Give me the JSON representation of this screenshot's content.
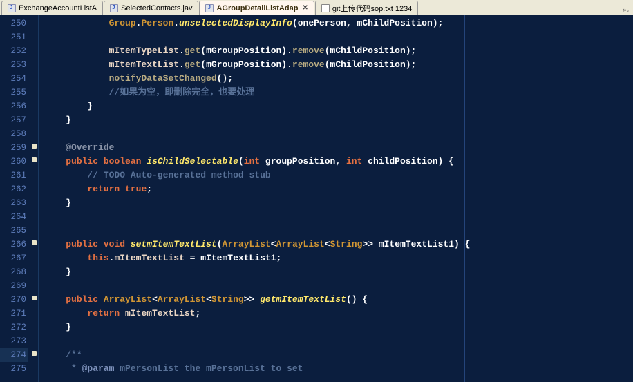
{
  "tabs": [
    {
      "label": "ExchangeAccountListA",
      "icon": "java",
      "active": false
    },
    {
      "label": "SelectedContacts.jav",
      "icon": "java",
      "active": false
    },
    {
      "label": "AGroupDetailListAdap",
      "icon": "java",
      "active": true
    },
    {
      "label": "git上传代码sop.txt 1234",
      "icon": "txt",
      "active": false
    }
  ],
  "overflow_label": "»₃",
  "line_start": 250,
  "line_end": 275,
  "markers": {
    "259": true,
    "260": true,
    "266": true,
    "270": true,
    "274": true
  },
  "highlight_gutter": {
    "274": true
  },
  "code": {
    "250": [
      {
        "t": "            ",
        "c": "tk-default"
      },
      {
        "t": "Group",
        "c": "tk-type"
      },
      {
        "t": ".",
        "c": "tk-punct"
      },
      {
        "t": "Person",
        "c": "tk-type"
      },
      {
        "t": ".",
        "c": "tk-punct"
      },
      {
        "t": "unselectedDisplayInfo",
        "c": "tk-method"
      },
      {
        "t": "(",
        "c": "tk-punct"
      },
      {
        "t": "onePerson",
        "c": "tk-ident"
      },
      {
        "t": ", ",
        "c": "tk-punct"
      },
      {
        "t": "mChildPosition",
        "c": "tk-ident"
      },
      {
        "t": ");",
        "c": "tk-punct"
      }
    ],
    "251": [],
    "252": [
      {
        "t": "            ",
        "c": "tk-default"
      },
      {
        "t": "mItemTypeList",
        "c": "tk-field"
      },
      {
        "t": ".",
        "c": "tk-punct"
      },
      {
        "t": "get",
        "c": "tk-call"
      },
      {
        "t": "(",
        "c": "tk-punct"
      },
      {
        "t": "mGroupPosition",
        "c": "tk-ident"
      },
      {
        "t": ").",
        "c": "tk-punct"
      },
      {
        "t": "remove",
        "c": "tk-call"
      },
      {
        "t": "(",
        "c": "tk-punct"
      },
      {
        "t": "mChildPosition",
        "c": "tk-ident"
      },
      {
        "t": ");",
        "c": "tk-punct"
      }
    ],
    "253": [
      {
        "t": "            ",
        "c": "tk-default"
      },
      {
        "t": "mItemTextList",
        "c": "tk-field"
      },
      {
        "t": ".",
        "c": "tk-punct"
      },
      {
        "t": "get",
        "c": "tk-call"
      },
      {
        "t": "(",
        "c": "tk-punct"
      },
      {
        "t": "mGroupPosition",
        "c": "tk-ident"
      },
      {
        "t": ").",
        "c": "tk-punct"
      },
      {
        "t": "remove",
        "c": "tk-call"
      },
      {
        "t": "(",
        "c": "tk-punct"
      },
      {
        "t": "mChildPosition",
        "c": "tk-ident"
      },
      {
        "t": ");",
        "c": "tk-punct"
      }
    ],
    "254": [
      {
        "t": "            ",
        "c": "tk-default"
      },
      {
        "t": "notifyDataSetChanged",
        "c": "tk-call"
      },
      {
        "t": "();",
        "c": "tk-punct"
      }
    ],
    "255": [
      {
        "t": "            ",
        "c": "tk-default"
      },
      {
        "t": "//如果为空，即删除完全，也要处理",
        "c": "tk-comment"
      }
    ],
    "256": [
      {
        "t": "        }",
        "c": "tk-punct"
      }
    ],
    "257": [
      {
        "t": "    }",
        "c": "tk-punct"
      }
    ],
    "258": [],
    "259": [
      {
        "t": "    ",
        "c": "tk-default"
      },
      {
        "t": "@Override",
        "c": "tk-annot"
      }
    ],
    "260": [
      {
        "t": "    ",
        "c": "tk-default"
      },
      {
        "t": "public",
        "c": "tk-kw"
      },
      {
        "t": " ",
        "c": "tk-default"
      },
      {
        "t": "boolean",
        "c": "tk-kw"
      },
      {
        "t": " ",
        "c": "tk-default"
      },
      {
        "t": "isChildSelectable",
        "c": "tk-method"
      },
      {
        "t": "(",
        "c": "tk-punct"
      },
      {
        "t": "int",
        "c": "tk-kw"
      },
      {
        "t": " groupPosition, ",
        "c": "tk-ident"
      },
      {
        "t": "int",
        "c": "tk-kw"
      },
      {
        "t": " childPosition) {",
        "c": "tk-ident"
      }
    ],
    "261": [
      {
        "t": "        ",
        "c": "tk-default"
      },
      {
        "t": "// ",
        "c": "tk-comment"
      },
      {
        "t": "TODO",
        "c": "tk-comment"
      },
      {
        "t": " Auto-generated method stub",
        "c": "tk-comment"
      }
    ],
    "262": [
      {
        "t": "        ",
        "c": "tk-default"
      },
      {
        "t": "return",
        "c": "tk-kw"
      },
      {
        "t": " ",
        "c": "tk-default"
      },
      {
        "t": "true",
        "c": "tk-kw"
      },
      {
        "t": ";",
        "c": "tk-punct"
      }
    ],
    "263": [
      {
        "t": "    }",
        "c": "tk-punct"
      }
    ],
    "264": [],
    "265": [],
    "266": [
      {
        "t": "    ",
        "c": "tk-default"
      },
      {
        "t": "public",
        "c": "tk-kw"
      },
      {
        "t": " ",
        "c": "tk-default"
      },
      {
        "t": "void",
        "c": "tk-kw"
      },
      {
        "t": " ",
        "c": "tk-default"
      },
      {
        "t": "setmItemTextList",
        "c": "tk-method"
      },
      {
        "t": "(",
        "c": "tk-punct"
      },
      {
        "t": "ArrayList",
        "c": "tk-type"
      },
      {
        "t": "<",
        "c": "tk-punct"
      },
      {
        "t": "ArrayList",
        "c": "tk-type"
      },
      {
        "t": "<",
        "c": "tk-punct"
      },
      {
        "t": "String",
        "c": "tk-type"
      },
      {
        "t": ">> ",
        "c": "tk-punct"
      },
      {
        "t": "mItemTextList1",
        "c": "tk-ident"
      },
      {
        "t": ") {",
        "c": "tk-punct"
      }
    ],
    "267": [
      {
        "t": "        ",
        "c": "tk-default"
      },
      {
        "t": "this",
        "c": "tk-kw"
      },
      {
        "t": ".",
        "c": "tk-punct"
      },
      {
        "t": "mItemTextList",
        "c": "tk-field"
      },
      {
        "t": " = mItemTextList1;",
        "c": "tk-ident"
      }
    ],
    "268": [
      {
        "t": "    }",
        "c": "tk-punct"
      }
    ],
    "269": [],
    "270": [
      {
        "t": "    ",
        "c": "tk-default"
      },
      {
        "t": "public",
        "c": "tk-kw"
      },
      {
        "t": " ",
        "c": "tk-default"
      },
      {
        "t": "ArrayList",
        "c": "tk-type"
      },
      {
        "t": "<",
        "c": "tk-punct"
      },
      {
        "t": "ArrayList",
        "c": "tk-type"
      },
      {
        "t": "<",
        "c": "tk-punct"
      },
      {
        "t": "String",
        "c": "tk-type"
      },
      {
        "t": ">> ",
        "c": "tk-punct"
      },
      {
        "t": "getmItemTextList",
        "c": "tk-method"
      },
      {
        "t": "() {",
        "c": "tk-punct"
      }
    ],
    "271": [
      {
        "t": "        ",
        "c": "tk-default"
      },
      {
        "t": "return",
        "c": "tk-kw"
      },
      {
        "t": " ",
        "c": "tk-default"
      },
      {
        "t": "mItemTextList",
        "c": "tk-field"
      },
      {
        "t": ";",
        "c": "tk-punct"
      }
    ],
    "272": [
      {
        "t": "    }",
        "c": "tk-punct"
      }
    ],
    "273": [],
    "274": [
      {
        "t": "    ",
        "c": "tk-default"
      },
      {
        "t": "/**",
        "c": "tk-doc"
      }
    ],
    "275": [
      {
        "t": "     * ",
        "c": "tk-doc"
      },
      {
        "t": "@param",
        "c": "tk-doctag"
      },
      {
        "t": " mPersonList the mPersonList to set",
        "c": "tk-doc"
      },
      {
        "cursor": true
      }
    ]
  }
}
